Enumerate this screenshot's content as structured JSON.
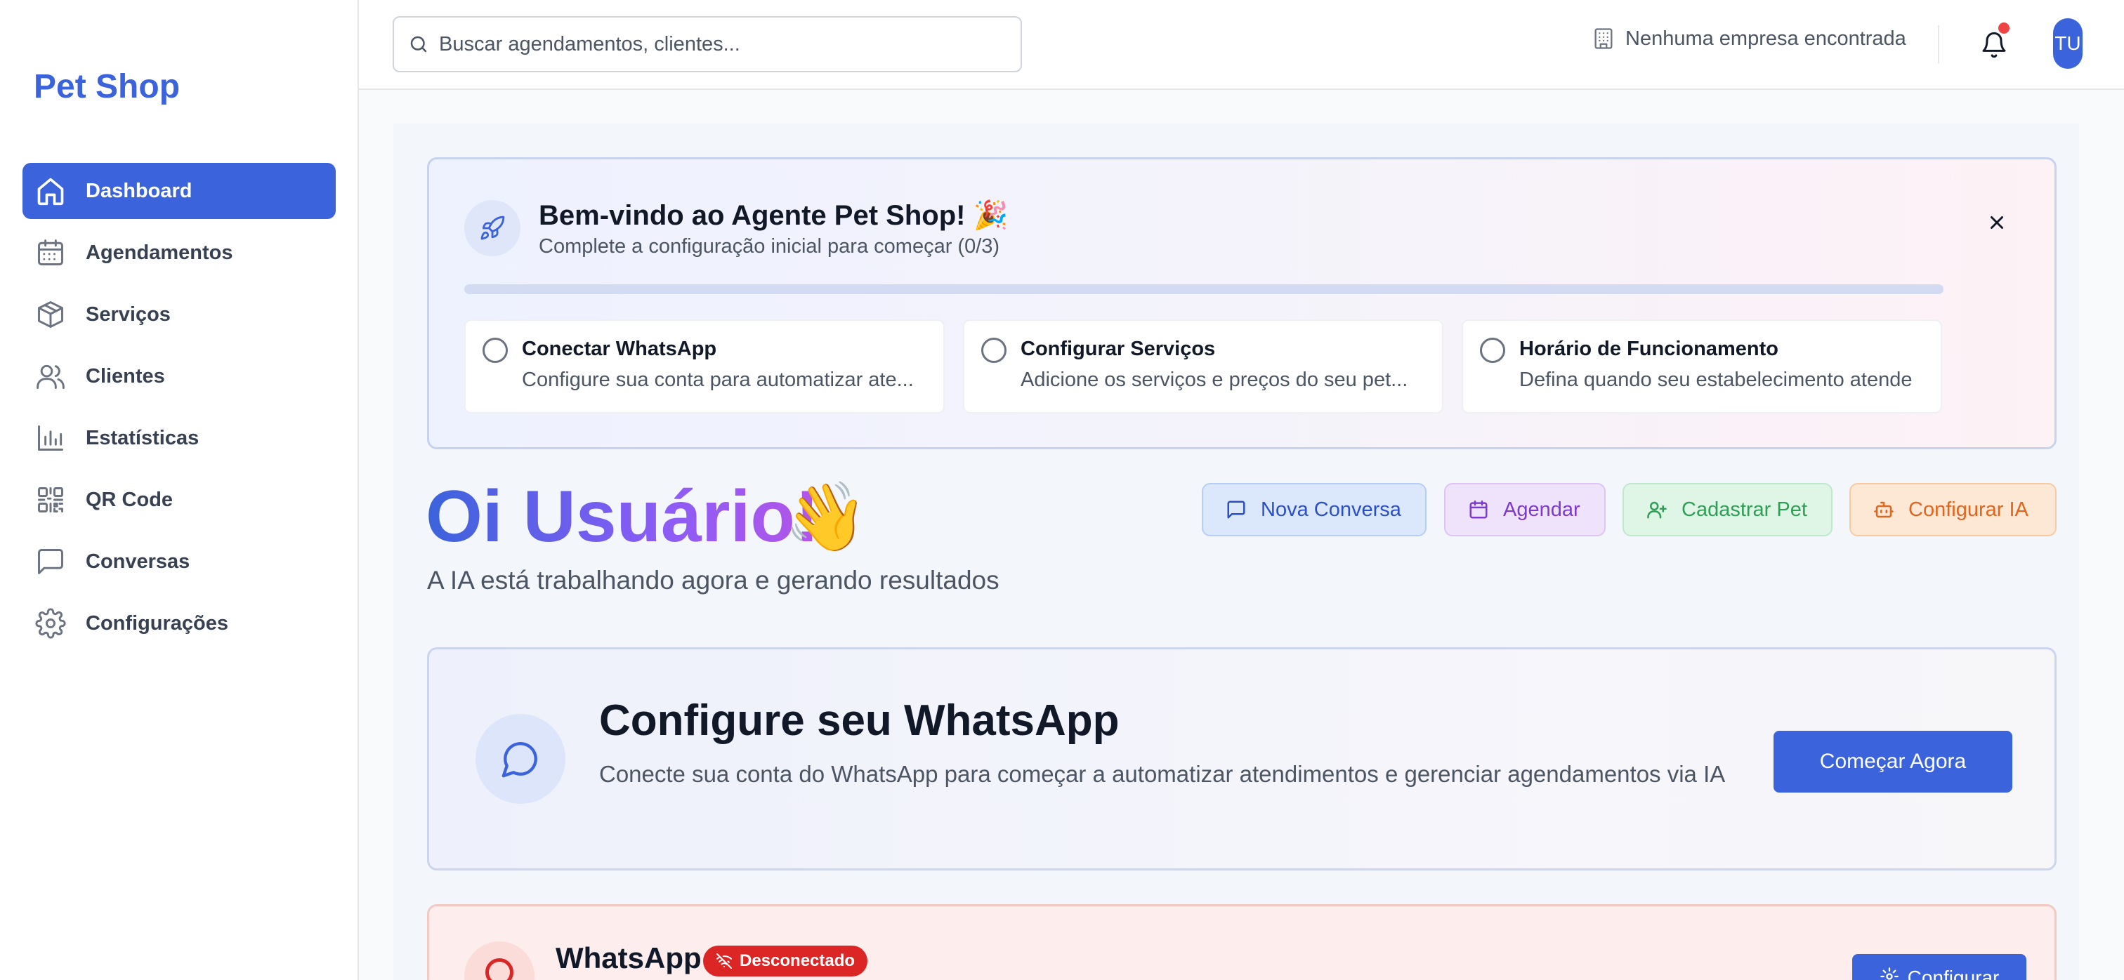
{
  "app": {
    "brand": "Pet Shop"
  },
  "sidebar": {
    "items": [
      {
        "label": "Dashboard",
        "icon": "home-icon",
        "active": true
      },
      {
        "label": "Agendamentos",
        "icon": "calendar-icon"
      },
      {
        "label": "Serviços",
        "icon": "package-icon"
      },
      {
        "label": "Clientes",
        "icon": "users-icon"
      },
      {
        "label": "Estatísticas",
        "icon": "bar-chart-icon"
      },
      {
        "label": "QR Code",
        "icon": "qr-code-icon"
      },
      {
        "label": "Conversas",
        "icon": "message-square-icon"
      },
      {
        "label": "Configurações",
        "icon": "settings-icon"
      }
    ]
  },
  "topbar": {
    "search_placeholder": "Buscar agendamentos, clientes...",
    "company": "Nenhuma empresa encontrada",
    "notification_unread": true,
    "avatar_initials": "TU"
  },
  "welcome": {
    "title": "Bem-vindo ao Agente Pet Shop!",
    "emoji": "🎉",
    "subtitle": "Complete a configuração inicial para começar (0/3)",
    "progress": 0,
    "steps": [
      {
        "title": "Conectar WhatsApp",
        "desc": "Configure sua conta para automatizar ate...",
        "done": false
      },
      {
        "title": "Configurar Serviços",
        "desc": "Adicione os serviços e preços do seu pet...",
        "done": false
      },
      {
        "title": "Horário de Funcionamento",
        "desc": "Defina quando seu estabelecimento atende",
        "done": false
      }
    ]
  },
  "greeting": {
    "title": "Oi Usuário!",
    "emoji": "👋",
    "subtitle": "A IA está trabalhando agora e gerando resultados"
  },
  "quick_actions": {
    "new_chat": "Nova Conversa",
    "schedule": "Agendar",
    "register_pet": "Cadastrar Pet",
    "configure_ai": "Configurar IA"
  },
  "whatsapp_setup": {
    "title": "Configure seu WhatsApp",
    "description": "Conecte sua conta do WhatsApp para começar a automatizar atendimentos e gerenciar agendamentos via IA",
    "button": "Começar Agora"
  },
  "whatsapp_status": {
    "title": "WhatsApp",
    "badge": "Desconectado",
    "button": "Configurar"
  },
  "colors": {
    "primary": "#3b63dc",
    "danger": "#dc2626",
    "purple": "#7e3ad0",
    "green": "#2f9e57",
    "orange": "#e1651c"
  }
}
